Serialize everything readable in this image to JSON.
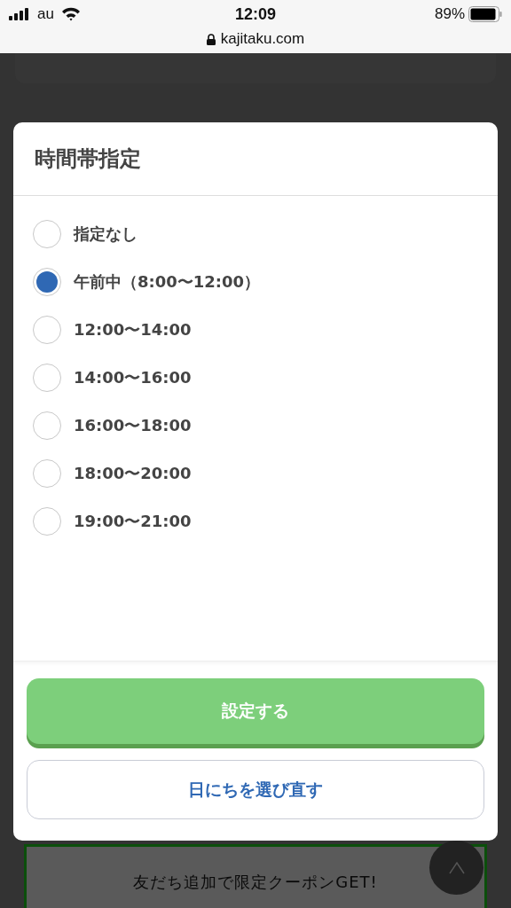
{
  "status_bar": {
    "carrier": "au",
    "time": "12:09",
    "battery": "89%",
    "url": "kajitaku.com"
  },
  "dialog": {
    "title": "時間帯指定",
    "options": [
      {
        "label": "指定なし",
        "selected": false
      },
      {
        "label": "午前中（8:00〜12:00）",
        "selected": true
      },
      {
        "label": "12:00〜14:00",
        "selected": false
      },
      {
        "label": "14:00〜16:00",
        "selected": false
      },
      {
        "label": "16:00〜18:00",
        "selected": false
      },
      {
        "label": "18:00〜20:00",
        "selected": false
      },
      {
        "label": "19:00〜21:00",
        "selected": false
      }
    ],
    "buttons": [
      {
        "label": "設定する",
        "kind": "primary"
      },
      {
        "label": "日にちを選び直す",
        "kind": "secondary"
      }
    ]
  },
  "banner": {
    "text": "友だち追加で限定クーポンGET!"
  }
}
